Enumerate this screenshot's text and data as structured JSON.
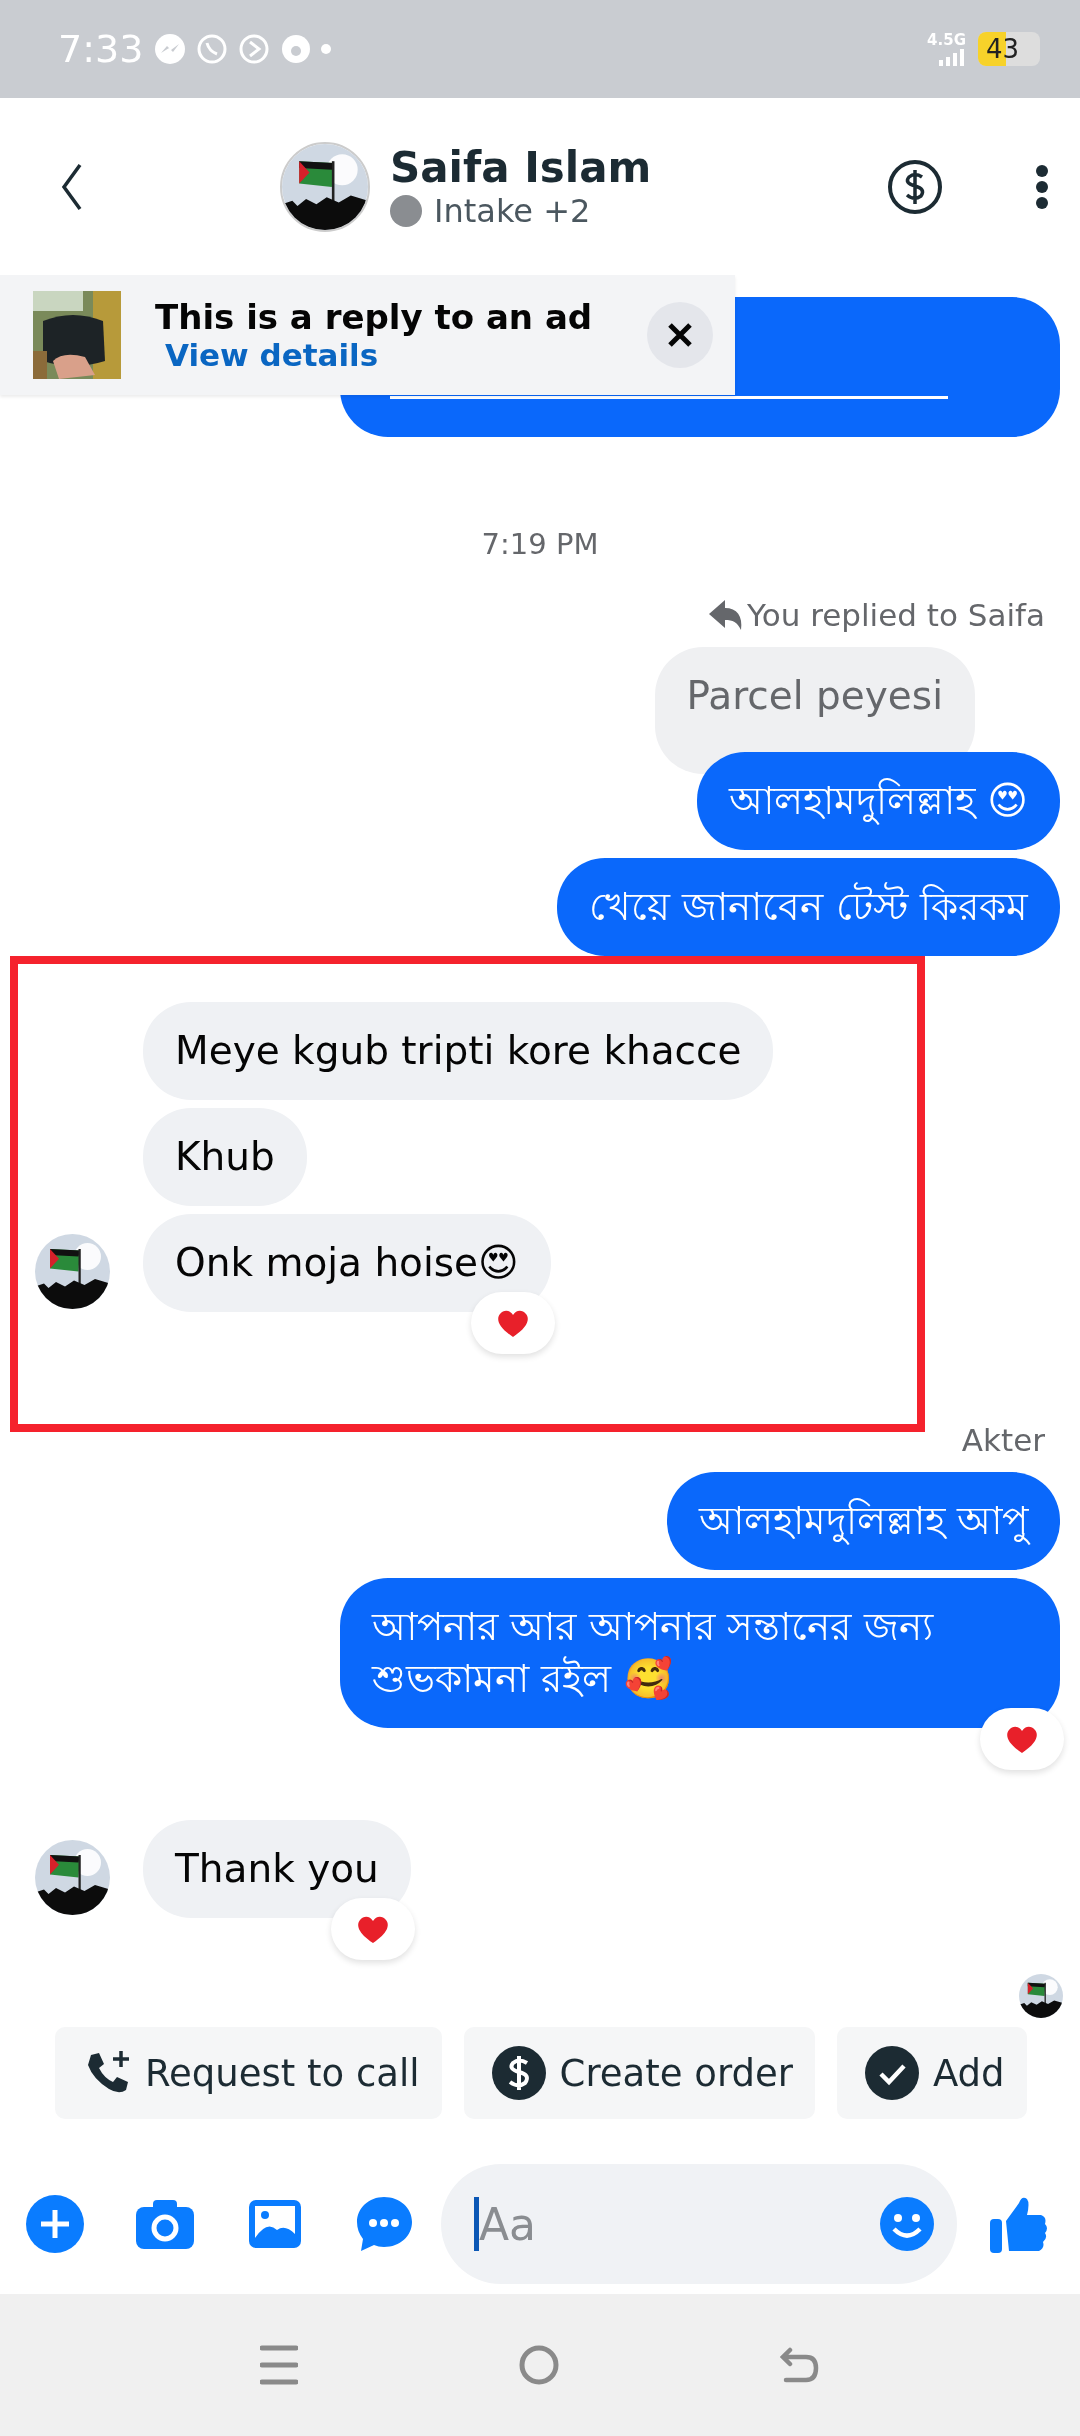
{
  "status_bar": {
    "time": "7:33",
    "network": "4.5G",
    "battery": "43"
  },
  "header": {
    "name": "Saifa Islam",
    "subtitle": "Intake +2"
  },
  "ad_banner": {
    "title": "This is a reply to an ad",
    "link": "View details"
  },
  "messages": [
    {
      "kind": "sent",
      "link": true
    },
    {
      "kind": "timestamp",
      "text": "7:19 PM"
    },
    {
      "kind": "reply_note",
      "text": "You replied to Saifa"
    },
    {
      "kind": "quoted",
      "text": "Parcel peyesi"
    },
    {
      "kind": "sent",
      "text": "আলহামদুলিল্লাহ 😍"
    },
    {
      "kind": "sent",
      "text": "খেয়ে জানাবেন টেস্ট কিরকম"
    },
    {
      "kind": "received",
      "text": "Meye kgub tripti kore khacce",
      "avatar": false,
      "highlighted": true
    },
    {
      "kind": "received",
      "text": "Khub",
      "avatar": false,
      "highlighted": true
    },
    {
      "kind": "received",
      "text": "Onk moja hoise😍",
      "avatar": true,
      "highlighted": true,
      "reacted": true
    },
    {
      "kind": "sender",
      "text": "Akter"
    },
    {
      "kind": "sent",
      "text": "আলহামদুলিল্লাহ আপু"
    },
    {
      "kind": "sent",
      "text": "আপনার আর আপনার সন্তানের জন্য শুভকামনা রইল 🥰",
      "reacted": true
    },
    {
      "kind": "received",
      "text": "Thank you",
      "avatar": true,
      "highlighted": false,
      "reacted": true
    },
    {
      "kind": "seen"
    }
  ],
  "quick_actions": [
    {
      "kind": "phone",
      "label": "Request to call"
    },
    {
      "kind": "dollar",
      "label": "Create order"
    },
    {
      "kind": "check",
      "label": "Add"
    }
  ],
  "composer": {
    "placeholder": "Aa"
  }
}
